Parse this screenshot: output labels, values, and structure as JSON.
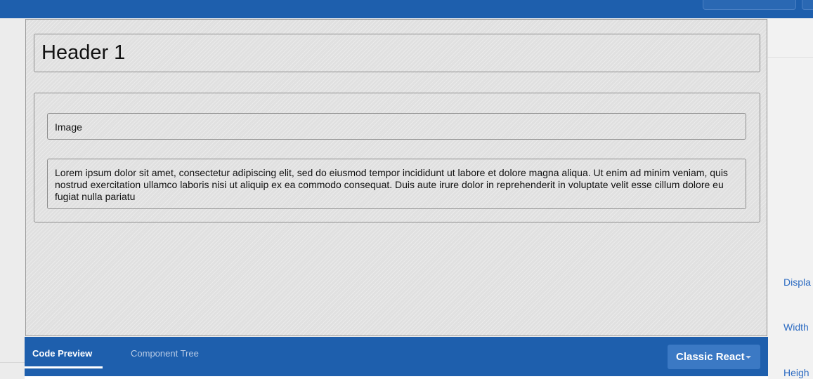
{
  "canvas": {
    "header_text": "Header 1",
    "image_label": "Image",
    "paragraph": "Lorem ipsum dolor sit amet, consectetur adipiscing elit, sed do eiusmod tempor incididunt ut labore et dolore magna aliqua. Ut enim ad minim veniam, quis nostrud exercitation ullamco laboris nisi ut aliquip ex ea commodo consequat. Duis aute irure dolor in reprehenderit in voluptate velit esse cillum dolore eu fugiat nulla pariatu"
  },
  "bottom_panel": {
    "tabs": [
      {
        "label": "Code Preview",
        "active": true
      },
      {
        "label": "Component Tree",
        "active": false
      }
    ],
    "framework_select": "Classic React"
  },
  "properties": {
    "labels": [
      "Displa",
      "Width",
      "Heigh"
    ]
  },
  "colors": {
    "primary": "#1e5fad",
    "select_bg": "#3b79c4",
    "link": "#2c6bc2",
    "canvas_bg": "#e0e0e0"
  },
  "icons": {
    "select_caret": "chevron-down-icon"
  }
}
